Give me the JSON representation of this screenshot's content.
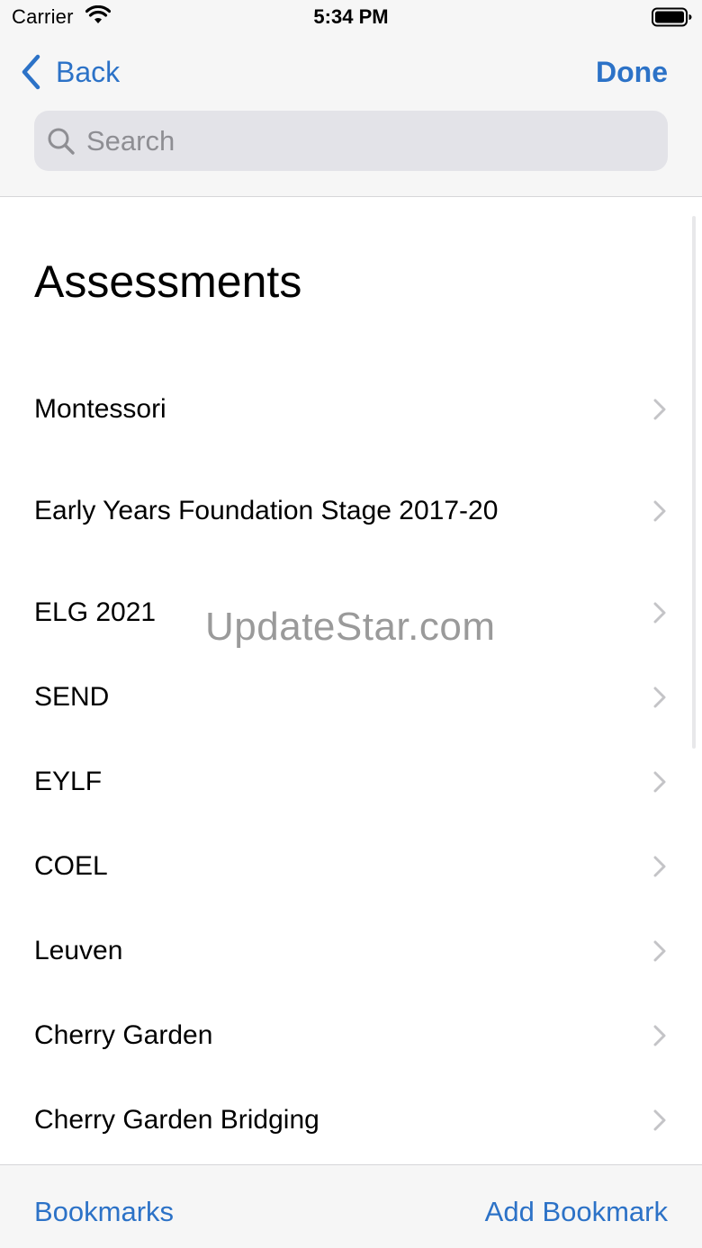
{
  "status_bar": {
    "carrier": "Carrier",
    "time": "5:34 PM"
  },
  "nav": {
    "back_label": "Back",
    "done_label": "Done"
  },
  "search": {
    "placeholder": "Search",
    "value": ""
  },
  "content": {
    "title": "Assessments",
    "items": [
      {
        "label": "Montessori"
      },
      {
        "label": "Early Years Foundation Stage 2017-20"
      },
      {
        "label": "ELG 2021"
      },
      {
        "label": "SEND"
      },
      {
        "label": "EYLF"
      },
      {
        "label": "COEL"
      },
      {
        "label": "Leuven"
      },
      {
        "label": "Cherry Garden"
      },
      {
        "label": "Cherry Garden Bridging"
      }
    ]
  },
  "watermark": "UpdateStar.com",
  "toolbar": {
    "bookmarks_label": "Bookmarks",
    "add_bookmark_label": "Add Bookmark"
  },
  "colors": {
    "accent": "#2c72c7",
    "chrome_background": "#f6f6f6",
    "search_background": "#e3e3e8",
    "placeholder": "#8e8e93",
    "chevron": "#c4c4c7"
  },
  "icons": {
    "wifi": "wifi-icon",
    "battery": "battery-icon",
    "back": "chevron-left-icon",
    "search": "search-icon",
    "disclosure": "chevron-right-icon"
  }
}
